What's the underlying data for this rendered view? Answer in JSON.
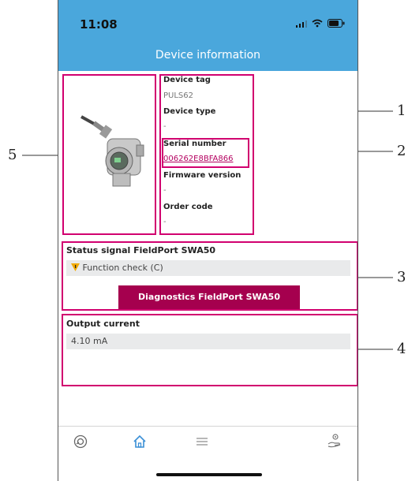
{
  "status_bar": {
    "time": "11:08"
  },
  "header": {
    "title": "Device information"
  },
  "device_info": {
    "device_tag_label": "Device tag",
    "device_tag_value": "PULS62",
    "device_type_label": "Device type",
    "device_type_value": "-",
    "serial_number_label": "Serial number",
    "serial_number_value": "006262E8BFA866",
    "firmware_label": "Firmware version",
    "firmware_value": "-",
    "order_code_label": "Order code",
    "order_code_value": "-"
  },
  "status_signal": {
    "title": "Status signal FieldPort SWA50",
    "value": "Function check (C)",
    "button_label": "Diagnostics FieldPort SWA50"
  },
  "output_current": {
    "title": "Output current",
    "value": "4.10 mA"
  },
  "bottom_nav": {
    "items": [
      "device-icon",
      "home-icon",
      "menu-icon",
      "settings-hand-icon"
    ]
  },
  "callouts": {
    "c1": "1",
    "c2": "2",
    "c3": "3",
    "c4": "4",
    "c5": "5"
  },
  "colors": {
    "header": "#4aa7dc",
    "highlight": "#d1006f",
    "button": "#a5004e",
    "warning": "#f2a900"
  }
}
